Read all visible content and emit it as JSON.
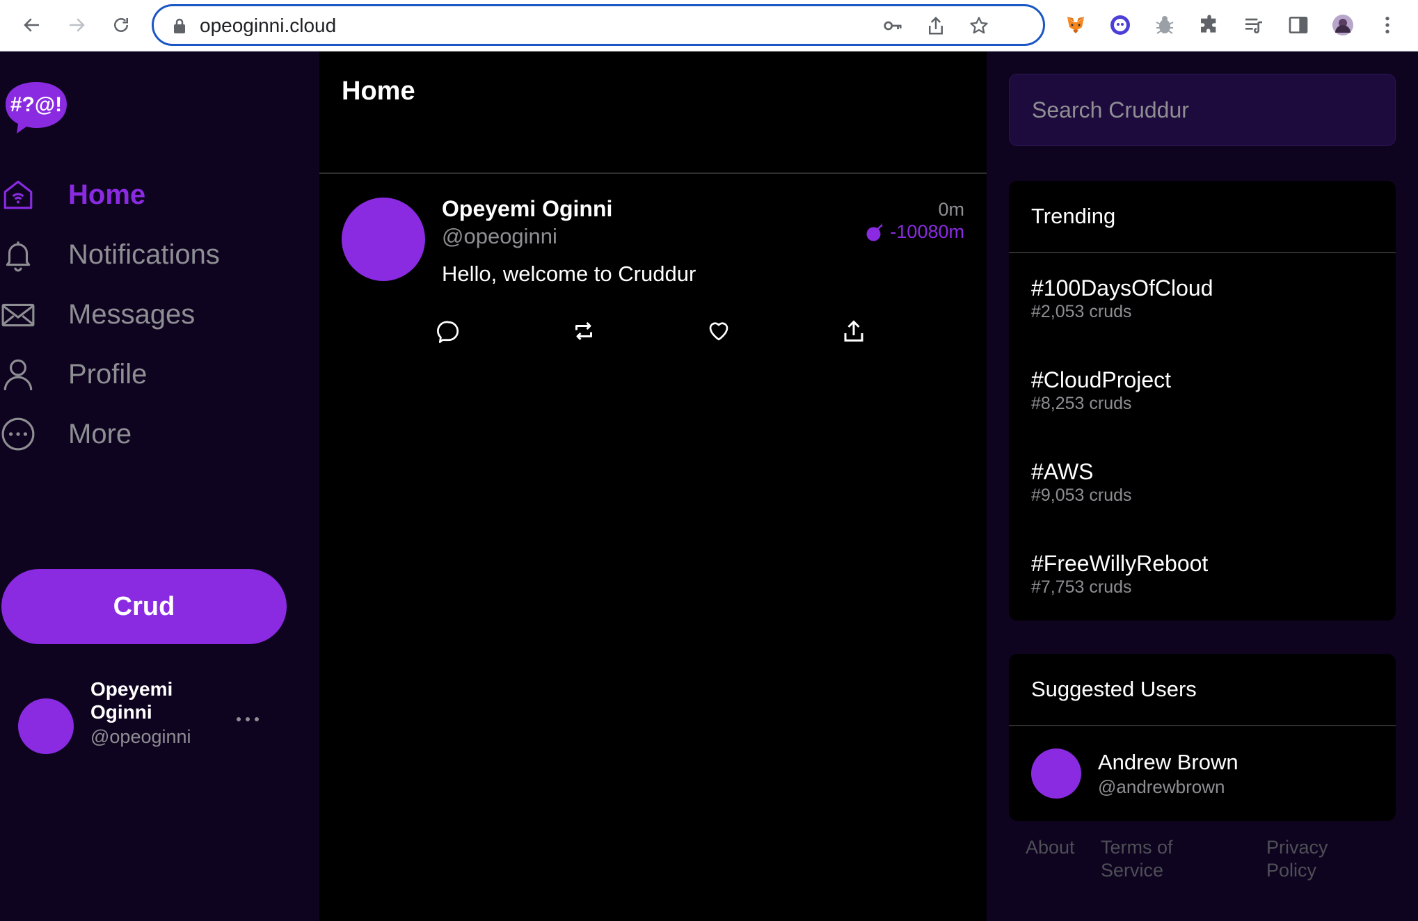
{
  "browser": {
    "url": "opeoginni.cloud",
    "accent_color": "#1a56c4"
  },
  "app": {
    "logo_text": "#?@!",
    "brand_color": "#8a2be2"
  },
  "sidebar": {
    "items": [
      {
        "label": "Home",
        "icon": "home-icon",
        "active": true
      },
      {
        "label": "Notifications",
        "icon": "bell-icon",
        "active": false
      },
      {
        "label": "Messages",
        "icon": "envelope-icon",
        "active": false
      },
      {
        "label": "Profile",
        "icon": "person-icon",
        "active": false
      },
      {
        "label": "More",
        "icon": "more-circle-icon",
        "active": false
      }
    ],
    "crud_button": "Crud",
    "profile": {
      "name": "Opeyemi Oginni",
      "handle": "@opeoginni"
    }
  },
  "feed": {
    "title": "Home",
    "posts": [
      {
        "author": "Opeyemi Oginni",
        "handle": "@opeoginni",
        "time": "0m",
        "expires": "-10080m",
        "body": "Hello, welcome to Cruddur"
      }
    ]
  },
  "search": {
    "placeholder": "Search Cruddur"
  },
  "trending": {
    "title": "Trending",
    "items": [
      {
        "tag": "#100DaysOfCloud",
        "count": "#2,053 cruds"
      },
      {
        "tag": "#CloudProject",
        "count": "#8,253 cruds"
      },
      {
        "tag": "#AWS",
        "count": "#9,053 cruds"
      },
      {
        "tag": "#FreeWillyReboot",
        "count": "#7,753 cruds"
      }
    ]
  },
  "suggested": {
    "title": "Suggested Users",
    "users": [
      {
        "name": "Andrew Brown",
        "handle": "@andrewbrown"
      }
    ]
  },
  "footer": {
    "about": "About",
    "terms": "Terms of Service",
    "privacy": "Privacy Policy"
  }
}
